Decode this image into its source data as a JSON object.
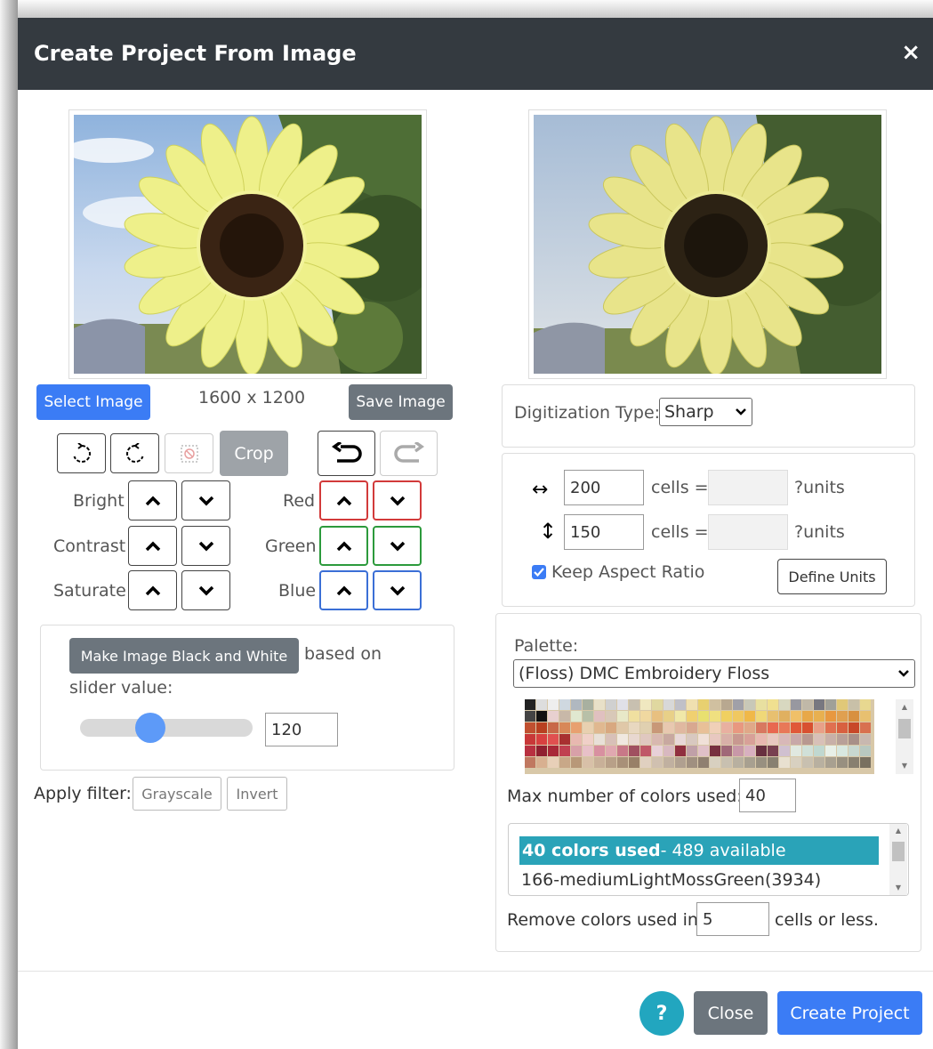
{
  "dialog": {
    "title": "Create Project From Image",
    "close_glyph": "×"
  },
  "left": {
    "select_image_label": "Select Image",
    "dimensions": "1600 x 1200",
    "save_image_label": "Save Image",
    "crop_label": "Crop",
    "adjustments": {
      "bright": "Bright",
      "contrast": "Contrast",
      "saturate": "Saturate",
      "red": "Red",
      "green": "Green",
      "blue": "Blue"
    },
    "bw": {
      "button_label": "Make Image Black and White",
      "based_on": "based on",
      "slider_value_label": "slider value:",
      "slider_value": "120",
      "slider_level": 0.39
    },
    "filter": {
      "label": "Apply filter:",
      "grayscale": "Grayscale",
      "invert": "Invert"
    }
  },
  "right": {
    "digitization_label": "Digitization Type:",
    "digitization_value": "Sharp",
    "width_cells": "200",
    "height_cells": "150",
    "cells_equals": "cells =",
    "units": "?units",
    "keep_aspect": "Keep Aspect Ratio",
    "keep_aspect_checked": true,
    "define_units": "Define Units",
    "palette_label": "Palette:",
    "palette_value": "(Floss) DMC Embroidery Floss",
    "max_colors_label": "Max number of colors used:",
    "max_colors_value": "40",
    "colors_used_bold": "40 colors used",
    "colors_available": " - 489 available",
    "color_item": "166-mediumLightMossGreen(3934)",
    "remove_label_pre": "Remove colors used in",
    "remove_value": "5",
    "remove_label_post": "cells or less."
  },
  "footer": {
    "help_label": "?",
    "close_label": "Close",
    "create_label": "Create Project"
  },
  "colors": {
    "header_bg": "#343a40",
    "primary": "#3b7cf5",
    "secondary": "#6c757d",
    "info": "#22a6bf",
    "selection": "#2aa3b8"
  }
}
